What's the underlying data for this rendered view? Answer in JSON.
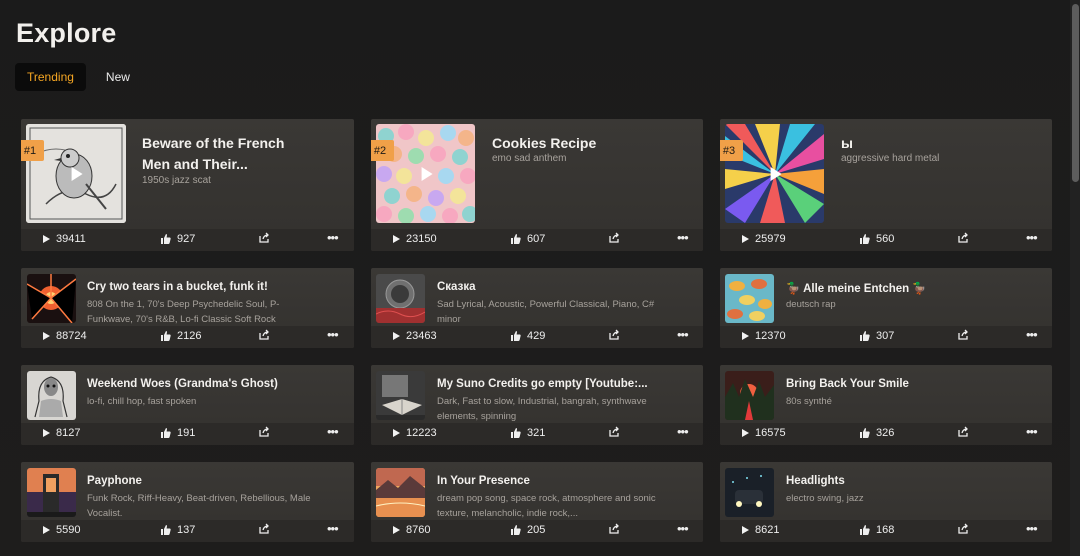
{
  "page": {
    "title": "Explore"
  },
  "tabs": [
    {
      "label": "Trending"
    },
    {
      "label": "New"
    }
  ],
  "accent": "#f0a048",
  "cards": [
    {
      "rank": "#1",
      "title": "Beware of the French Men and Their...",
      "subtitle": "1950s jazz scat",
      "plays": "39411",
      "likes": "927"
    },
    {
      "rank": "#2",
      "title": "Cookies Recipe",
      "subtitle": "emo sad anthem",
      "plays": "23150",
      "likes": "607"
    },
    {
      "rank": "#3",
      "title": "ы",
      "subtitle": "aggressive hard metal",
      "plays": "25979",
      "likes": "560"
    },
    {
      "title": "Cry two tears in a bucket, funk it!",
      "subtitle": "808 On the 1, 70's Deep Psychedelic Soul, P-Funkwave, 70's R&B, Lo-fi Classic Soft Rock",
      "plays": "88724",
      "likes": "2126"
    },
    {
      "title": "Сказка",
      "subtitle": "Sad Lyrical, Acoustic, Powerful Classical, Piano, C# minor",
      "plays": "23463",
      "likes": "429"
    },
    {
      "title": "🦆 Alle meine Entchen 🦆",
      "subtitle": "deutsch rap",
      "plays": "12370",
      "likes": "307"
    },
    {
      "title": "Weekend Woes (Grandma's Ghost)",
      "subtitle": "lo-fi, chill hop, fast spoken",
      "plays": "8127",
      "likes": "191"
    },
    {
      "title": "My Suno Credits go empty [Youtube:...",
      "subtitle": "Dark, Fast to slow, Industrial, bangrah, synthwave elements, spinning",
      "plays": "12223",
      "likes": "321"
    },
    {
      "title": "Bring Back Your Smile",
      "subtitle": "80s synthé",
      "plays": "16575",
      "likes": "326"
    },
    {
      "title": "Payphone",
      "subtitle": "Funk Rock, Riff-Heavy, Beat-driven, Rebellious, Male Vocalist.",
      "plays": "5590",
      "likes": "137"
    },
    {
      "title": "In Your Presence",
      "subtitle": "dream pop song, space rock, atmosphere and sonic texture, melancholic, indie rock,...",
      "plays": "8760",
      "likes": "205"
    },
    {
      "title": "Headlights",
      "subtitle": "electro swing, jazz",
      "plays": "8621",
      "likes": "168"
    }
  ]
}
